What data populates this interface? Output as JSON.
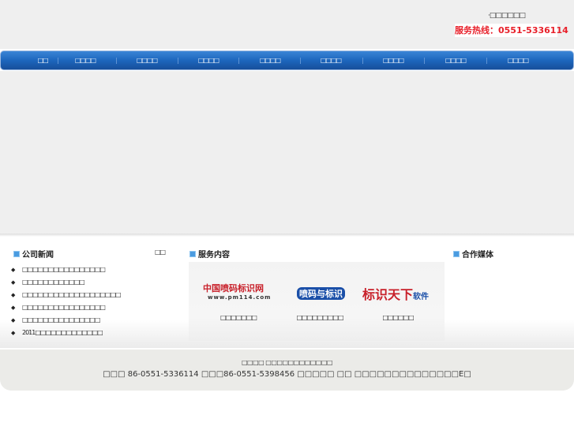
{
  "header": {
    "top_link": "·□□□□□□",
    "hotline": "服务热线：0551-5336114"
  },
  "nav": [
    "□□",
    "□□□□",
    "□□□□",
    "□□□□",
    "□□□□",
    "□□□□",
    "□□□□",
    "□□□□",
    "□□□□"
  ],
  "news": {
    "title": "公司新闻",
    "more": "□□",
    "items": [
      "□□□□□□□□□□□□□□□□",
      "□□□□□□□□□□□□",
      "□□□□□□□□□□□□□□□□□□□",
      "□□□□□□□□□□□□□□□□",
      "□□□□□□□□□□□□□□□",
      "2011□□□□□□□□□□□□□"
    ]
  },
  "services": {
    "title": "服务内容",
    "items": [
      {
        "logo": "中国喷码标识网",
        "logo_sub": "www.pm114.com",
        "caption": "□□□□□□□"
      },
      {
        "logo": "喷码与标识",
        "caption": "□□□□□□□□□"
      },
      {
        "logo": "标识天下",
        "logo_suffix": "软件",
        "caption": "□□□□□□"
      }
    ]
  },
  "media": {
    "title": "合作媒体"
  },
  "footer": {
    "line1": "□□□□ □□□□□□□□□□□□",
    "line2": "□□□ 86-0551-5336114 □□□86-0551-5398456 □□□□□ □□ □□□□□□□□□□□□□□E□"
  }
}
